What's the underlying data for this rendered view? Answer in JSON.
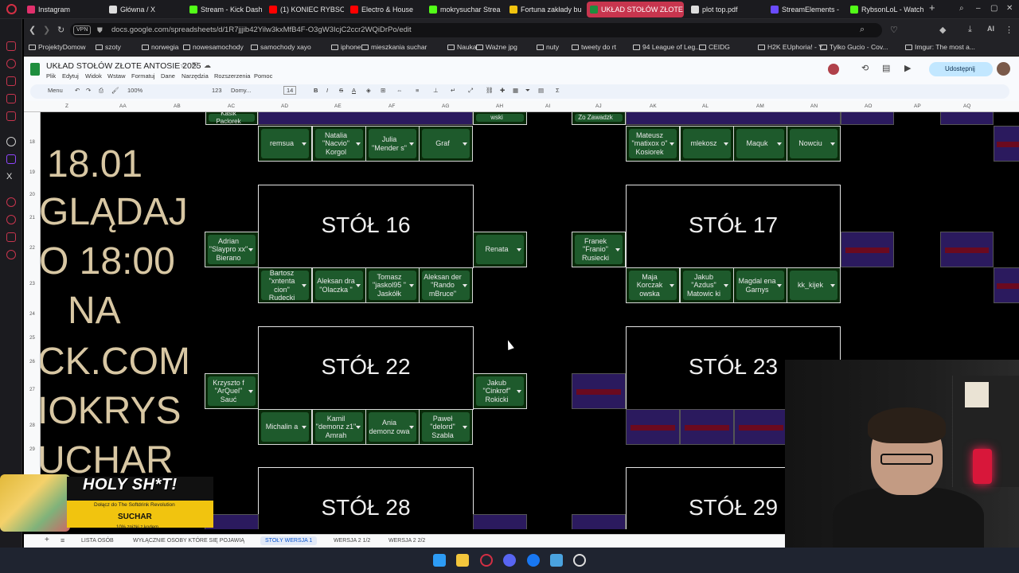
{
  "browser": {
    "tabs": [
      {
        "label": "Instagram",
        "color": "#e1306c"
      },
      {
        "label": "Główna / X",
        "color": "#dddddd"
      },
      {
        "label": "Stream - Kick Dash",
        "color": "#53fc18"
      },
      {
        "label": "(1) KONIEC RYBSO",
        "color": "#ff0000"
      },
      {
        "label": "Electro & House",
        "color": "#ff0000"
      },
      {
        "label": "mokrysuchar Strea",
        "color": "#53fc18"
      },
      {
        "label": "Fortuna zakłady bu",
        "color": "#f1c40f"
      },
      {
        "label": "UKŁAD STOŁÓW ZŁOTE A",
        "color": "#1e8e3e"
      },
      {
        "label": "plot top.pdf",
        "color": "#dddddd"
      },
      {
        "label": "StreamElements -",
        "color": "#6a4bff"
      },
      {
        "label": "RybsonLoL - Watch",
        "color": "#53fc18"
      }
    ],
    "new_tab": "+",
    "url": "docs.google.com/spreadsheets/d/1R7jjjib42Yilw3kxMfB4F-O3gW3IcjC2ccr2WQiDrPo/edit",
    "vpn": "VPN",
    "ai_label": "AI",
    "bookmarks": [
      "ProjektyDomow",
      "szoty",
      "norwegia",
      "nowesamochody",
      "samochody xayo",
      "iphone",
      "mieszkania suchar",
      "Nauka",
      "Ważne jpg",
      "nuty",
      "tweety do rt",
      "94 League of Leg...",
      "CEIDG",
      "H2K EUphoria! - Y...",
      "Tylko Gucio - Cov...",
      "Imgur: The most a..."
    ]
  },
  "sheets": {
    "title": "UKŁAD STOŁÓW ZŁOTE ANTOSIE 2025",
    "menus": [
      "Plik",
      "Edytuj",
      "Widok",
      "Wstaw",
      "Formatuj",
      "Dane",
      "Narzędzia",
      "Rozszerzenia",
      "Pomoc"
    ],
    "share_label": "Udostępnij",
    "toolbar": {
      "menu": "Menu",
      "zoom": "100%",
      "format": "123",
      "font": "Domy...",
      "size": "14"
    },
    "columns": [
      "Z",
      "AA",
      "AB",
      "AC",
      "AD",
      "AE",
      "AF",
      "AG",
      "AH",
      "AI",
      "AJ",
      "AK",
      "AL",
      "AM",
      "AN",
      "AO",
      "AP",
      "AQ"
    ],
    "rows": [
      "",
      "18",
      "19",
      "20",
      "21",
      "22",
      "23",
      "24",
      "25",
      "26",
      "27",
      "28",
      "29"
    ],
    "sheet_tabs": [
      "LISTA OSÓB",
      "WYŁĄCZNIE OSOBY KTÓRE SIĘ POJAWIĄ",
      "STOŁY WERSJA 1",
      "WERSJA 2 1/2",
      "WERSJA 2 2/2"
    ],
    "active_sheet": "STOŁY WERSJA 1",
    "big_text": [
      "18.01",
      "GLĄDAJ",
      "O 18:00",
      "NA",
      "CK.COM",
      "IOKRYS",
      "UCHAR"
    ],
    "tables": {
      "t16": "STÓŁ 16",
      "t17": "STÓŁ 17",
      "t22": "STÓŁ 22",
      "t23": "STÓŁ 23",
      "t28": "STÓŁ 28",
      "t29": "STÓŁ 29"
    },
    "names": {
      "top_partial_1": "Kasik Paclorek",
      "top_partial_2": "wski",
      "top_partial_3": "Zo Zawadzk",
      "r18": [
        "remsua",
        "Natalia \"Nacvio\" Korgol",
        "Julia \"Mender s\"",
        "Graf"
      ],
      "r18b": [
        "Mateusz \"matixox o\" Kosiorek",
        "mlekosz",
        "Maquk",
        "Nowciu"
      ],
      "t16_left": "Adrian \"Slaypro xx\" Bierano",
      "t16_right": "Renata",
      "t16_bottom": [
        "Bartosz \"xntenta cion\" Rudecki",
        "Aleksan dra \"Olaczka \"",
        "Tomasz \"jaskol95 \" Jaskółk",
        "Aleksan der \"Rando mBruce\""
      ],
      "t17_left": "Franek \"Franio\" Rusiecki",
      "t17_bottom": [
        "Maja Korczak owska",
        "Jakub \"Azdus\" Matowic ki",
        "Magdal ena Garnys",
        "kk_kijek"
      ],
      "t22_left": "Krzyszto f \"ArQuel\" Sauć",
      "t22_right": "Jakub \"Cinkrof\" Rokicki",
      "t22_bottom": [
        "Michalin a",
        "Kamil \"demonz z1\" Amrah",
        "Ania demonz owa",
        "Paweł \"delord\" Szabla"
      ]
    }
  },
  "ad": {
    "headline": "HOLY SH*T!",
    "line1": "Dołącz do The Softdrink Revolution",
    "line2": "SUCHAR",
    "line3": "10% zniżki z kodem"
  }
}
